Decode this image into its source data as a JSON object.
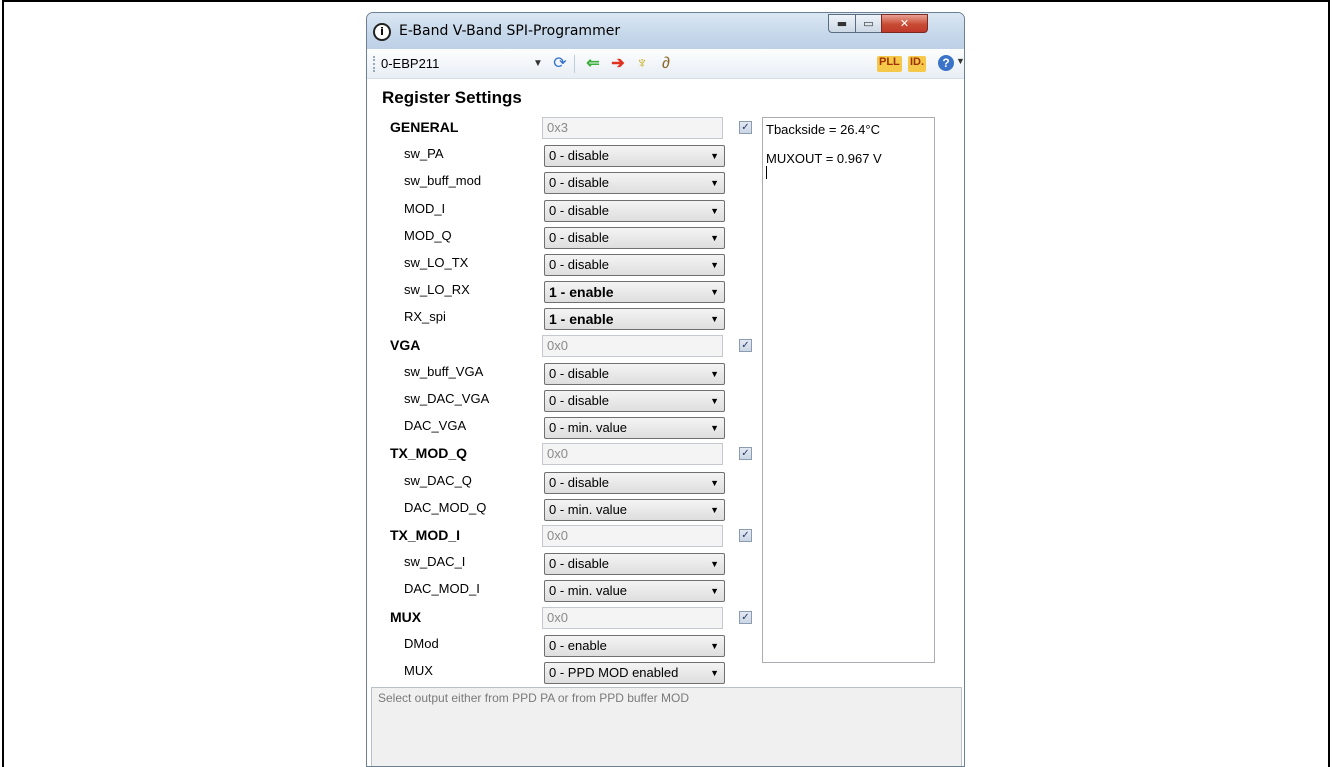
{
  "window": {
    "title": "E-Band V-Band SPI-Programmer",
    "app_icon_glyph": "i",
    "min_glyph": "▬",
    "max_glyph": "▭",
    "close_glyph": "✕"
  },
  "toolbar": {
    "device": "0-EBP211",
    "pll_label": "PLL",
    "id_label": "ID.",
    "help_glyph": "?"
  },
  "heading": "Register Settings",
  "registers": [
    {
      "name": "GENERAL",
      "hex": "0x3",
      "checked": true,
      "fields": [
        {
          "label": "sw_PA",
          "value": "0 - disable",
          "bold": false
        },
        {
          "label": "sw_buff_mod",
          "value": "0 - disable",
          "bold": false
        },
        {
          "label": "MOD_I",
          "value": "0 - disable",
          "bold": false
        },
        {
          "label": "MOD_Q",
          "value": "0 - disable",
          "bold": false
        },
        {
          "label": "sw_LO_TX",
          "value": "0 - disable",
          "bold": false
        },
        {
          "label": "sw_LO_RX",
          "value": "1 - enable",
          "bold": true
        },
        {
          "label": "RX_spi",
          "value": "1 - enable",
          "bold": true
        }
      ]
    },
    {
      "name": "VGA",
      "hex": "0x0",
      "checked": true,
      "fields": [
        {
          "label": "sw_buff_VGA",
          "value": "0 - disable",
          "bold": false
        },
        {
          "label": "sw_DAC_VGA",
          "value": "0 - disable",
          "bold": false
        },
        {
          "label": "DAC_VGA",
          "value": "0 - min. value",
          "bold": false
        }
      ]
    },
    {
      "name": "TX_MOD_Q",
      "hex": "0x0",
      "checked": true,
      "fields": [
        {
          "label": "sw_DAC_Q",
          "value": "0 - disable",
          "bold": false
        },
        {
          "label": "DAC_MOD_Q",
          "value": "0 - min. value",
          "bold": false
        }
      ]
    },
    {
      "name": "TX_MOD_I",
      "hex": "0x0",
      "checked": true,
      "fields": [
        {
          "label": "sw_DAC_I",
          "value": "0 - disable",
          "bold": false
        },
        {
          "label": "DAC_MOD_I",
          "value": "0 - min. value",
          "bold": false
        }
      ]
    },
    {
      "name": "MUX",
      "hex": "0x0",
      "checked": true,
      "fields": [
        {
          "label": "DMod",
          "value": "0 - enable",
          "bold": false
        },
        {
          "label": "MUX",
          "value": "0 - PPD MOD enabled",
          "bold": false
        }
      ]
    }
  ],
  "output": {
    "tbackside": "Tbackside = 26.4°C",
    "muxout": "MUXOUT = 0.967 V"
  },
  "description": "Select output either from PPD PA or from PPD buffer MOD",
  "colors": {
    "accent_green_arrow": "#3cae3c",
    "accent_red_arrow": "#e0301e",
    "refresh_blue": "#2f6fce"
  }
}
